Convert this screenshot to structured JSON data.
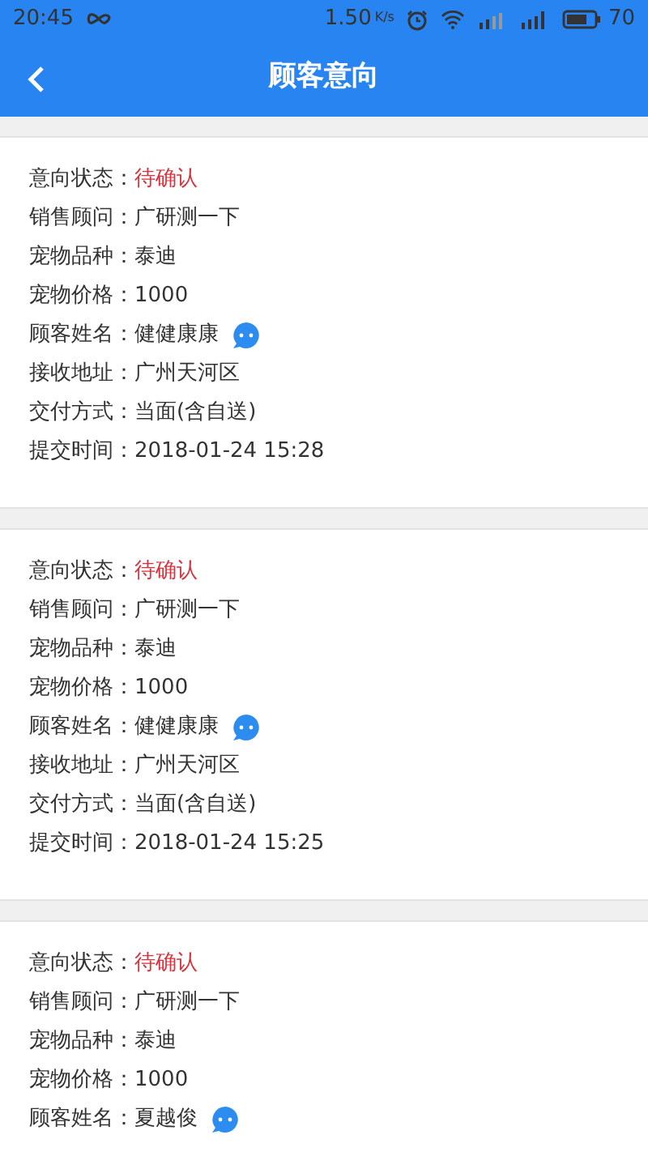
{
  "status_bar": {
    "time": "20:45",
    "speed": "1.50",
    "speed_unit": "K/s",
    "battery_text": "70"
  },
  "header": {
    "title": "顾客意向"
  },
  "cards": [
    {
      "fields": [
        {
          "kind": "status",
          "label": "意向状态：",
          "value": "待确认"
        },
        {
          "kind": "text",
          "label": "销售顾问：",
          "value": "广研测一下"
        },
        {
          "kind": "text",
          "label": "宠物品种：",
          "value": "泰迪"
        },
        {
          "kind": "text",
          "label": "宠物价格：",
          "value": "1000"
        },
        {
          "kind": "contact",
          "label": "顾客姓名：",
          "value": "健健康康"
        },
        {
          "kind": "text",
          "label": "接收地址：",
          "value": "广州天河区"
        },
        {
          "kind": "text",
          "label": "交付方式：",
          "value": "当面(含自送)"
        },
        {
          "kind": "text",
          "label": "提交时间：",
          "value": "2018-01-24 15:28"
        }
      ]
    },
    {
      "fields": [
        {
          "kind": "status",
          "label": "意向状态：",
          "value": "待确认"
        },
        {
          "kind": "text",
          "label": "销售顾问：",
          "value": "广研测一下"
        },
        {
          "kind": "text",
          "label": "宠物品种：",
          "value": "泰迪"
        },
        {
          "kind": "text",
          "label": "宠物价格：",
          "value": "1000"
        },
        {
          "kind": "contact",
          "label": "顾客姓名：",
          "value": "健健康康"
        },
        {
          "kind": "text",
          "label": "接收地址：",
          "value": "广州天河区"
        },
        {
          "kind": "text",
          "label": "交付方式：",
          "value": "当面(含自送)"
        },
        {
          "kind": "text",
          "label": "提交时间：",
          "value": "2018-01-24 15:25"
        }
      ]
    },
    {
      "fields": [
        {
          "kind": "status",
          "label": "意向状态：",
          "value": "待确认"
        },
        {
          "kind": "text",
          "label": "销售顾问：",
          "value": "广研测一下"
        },
        {
          "kind": "text",
          "label": "宠物品种：",
          "value": "泰迪"
        },
        {
          "kind": "text",
          "label": "宠物价格：",
          "value": "1000"
        },
        {
          "kind": "contact",
          "label": "顾客姓名：",
          "value": "夏越俊"
        }
      ]
    }
  ]
}
